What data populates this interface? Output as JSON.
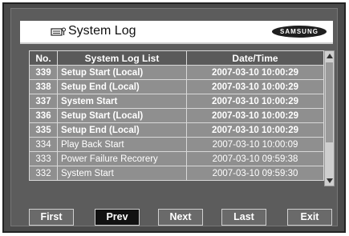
{
  "title": "System Log",
  "brand": "SAMSUNG",
  "table": {
    "columns": [
      "No.",
      "System Log List",
      "Date/Time"
    ],
    "rows": [
      {
        "no": "339",
        "event": "Setup Start (Local)",
        "datetime": "2007-03-10 10:00:29",
        "highlight": true
      },
      {
        "no": "338",
        "event": "Setup End (Local)",
        "datetime": "2007-03-10 10:00:29",
        "highlight": true
      },
      {
        "no": "337",
        "event": "System Start",
        "datetime": "2007-03-10 10:00:29",
        "highlight": true
      },
      {
        "no": "336",
        "event": "Setup Start (Local)",
        "datetime": "2007-03-10 10:00:29",
        "highlight": true
      },
      {
        "no": "335",
        "event": "Setup End (Local)",
        "datetime": "2007-03-10 10:00:29",
        "highlight": true
      },
      {
        "no": "334",
        "event": "Play Back Start",
        "datetime": "2007-03-10 10:00:09",
        "highlight": false
      },
      {
        "no": "333",
        "event": "Power Failure Recorery",
        "datetime": "2007-03-10 09:59:38",
        "highlight": false
      },
      {
        "no": "332",
        "event": "System Start",
        "datetime": "2007-03-10 09:59:30",
        "highlight": false
      }
    ]
  },
  "buttons": {
    "first": "First",
    "prev": "Prev",
    "next": "Next",
    "last": "Last",
    "exit": "Exit"
  },
  "icons": {
    "title": "keyboard-log-icon",
    "scroll_up": "arrow-up-icon",
    "scroll_down": "arrow-down-icon"
  }
}
